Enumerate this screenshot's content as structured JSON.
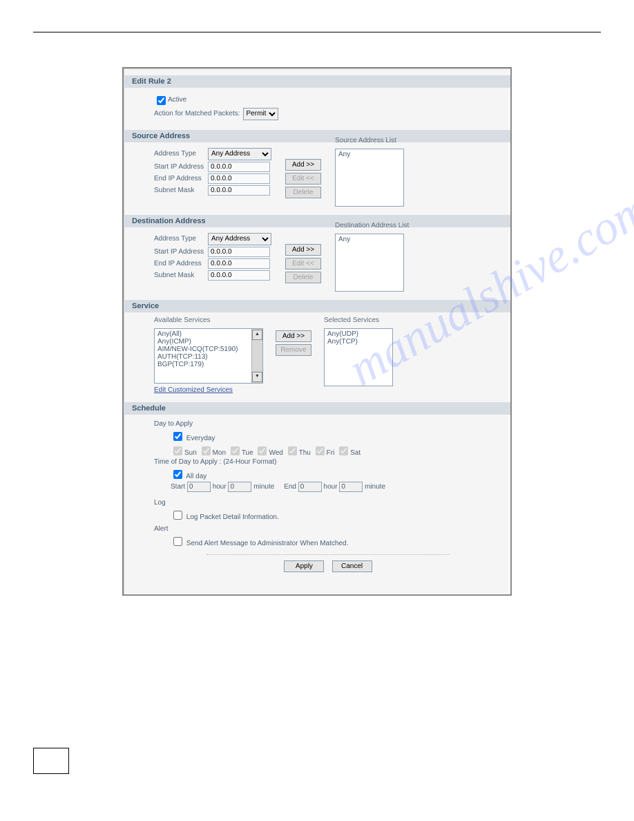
{
  "title": "Edit Rule 2",
  "general": {
    "active_label": "Active",
    "action_label": "Action for Matched Packets:",
    "action_value": "Permit"
  },
  "source": {
    "header": "Source Address",
    "address_type_label": "Address Type",
    "address_type_value": "Any Address",
    "start_ip_label": "Start IP Address",
    "start_ip_value": "0.0.0.0",
    "end_ip_label": "End IP Address",
    "end_ip_value": "0.0.0.0",
    "subnet_label": "Subnet Mask",
    "subnet_value": "0.0.0.0",
    "list_title": "Source Address List",
    "add_btn": "Add >>",
    "edit_btn": "Edit <<",
    "delete_btn": "Delete",
    "list_items": [
      "Any"
    ]
  },
  "dest": {
    "header": "Destination Address",
    "address_type_label": "Address Type",
    "address_type_value": "Any Address",
    "start_ip_label": "Start IP Address",
    "start_ip_value": "0.0.0.0",
    "end_ip_label": "End IP Address",
    "end_ip_value": "0.0.0.0",
    "subnet_label": "Subnet Mask",
    "subnet_value": "0.0.0.0",
    "list_title": "Destination Address List",
    "add_btn": "Add >>",
    "edit_btn": "Edit <<",
    "delete_btn": "Delete",
    "list_items": [
      "Any"
    ]
  },
  "service": {
    "header": "Service",
    "available_title": "Available Services",
    "available_items": [
      "Any(All)",
      "Any(ICMP)",
      "AIM/NEW-ICQ(TCP:5190)",
      "AUTH(TCP:113)",
      "BGP(TCP:179)"
    ],
    "selected_title": "Selected Services",
    "selected_items": [
      "Any(UDP)",
      "Any(TCP)"
    ],
    "add_btn": "Add >>",
    "remove_btn": "Remove",
    "edit_link": "Edit Customized Services"
  },
  "schedule": {
    "header": "Schedule",
    "day_apply": "Day to Apply",
    "everyday": "Everyday",
    "days": [
      "Sun",
      "Mon",
      "Tue",
      "Wed",
      "Thu",
      "Fri",
      "Sat"
    ],
    "time_apply": "Time of Day to Apply : (24-Hour Format)",
    "allday": "All day",
    "start_label": "Start",
    "end_label": "End",
    "hour_label": "hour",
    "minute_label": "minute",
    "start_hour": "0",
    "start_min": "0",
    "end_hour": "0",
    "end_min": "0",
    "log_label": "Log",
    "log_detail": "Log Packet Detail Information.",
    "alert_label": "Alert",
    "alert_detail": "Send Alert Message to Administrator When Matched."
  },
  "footer": {
    "apply": "Apply",
    "cancel": "Cancel"
  }
}
